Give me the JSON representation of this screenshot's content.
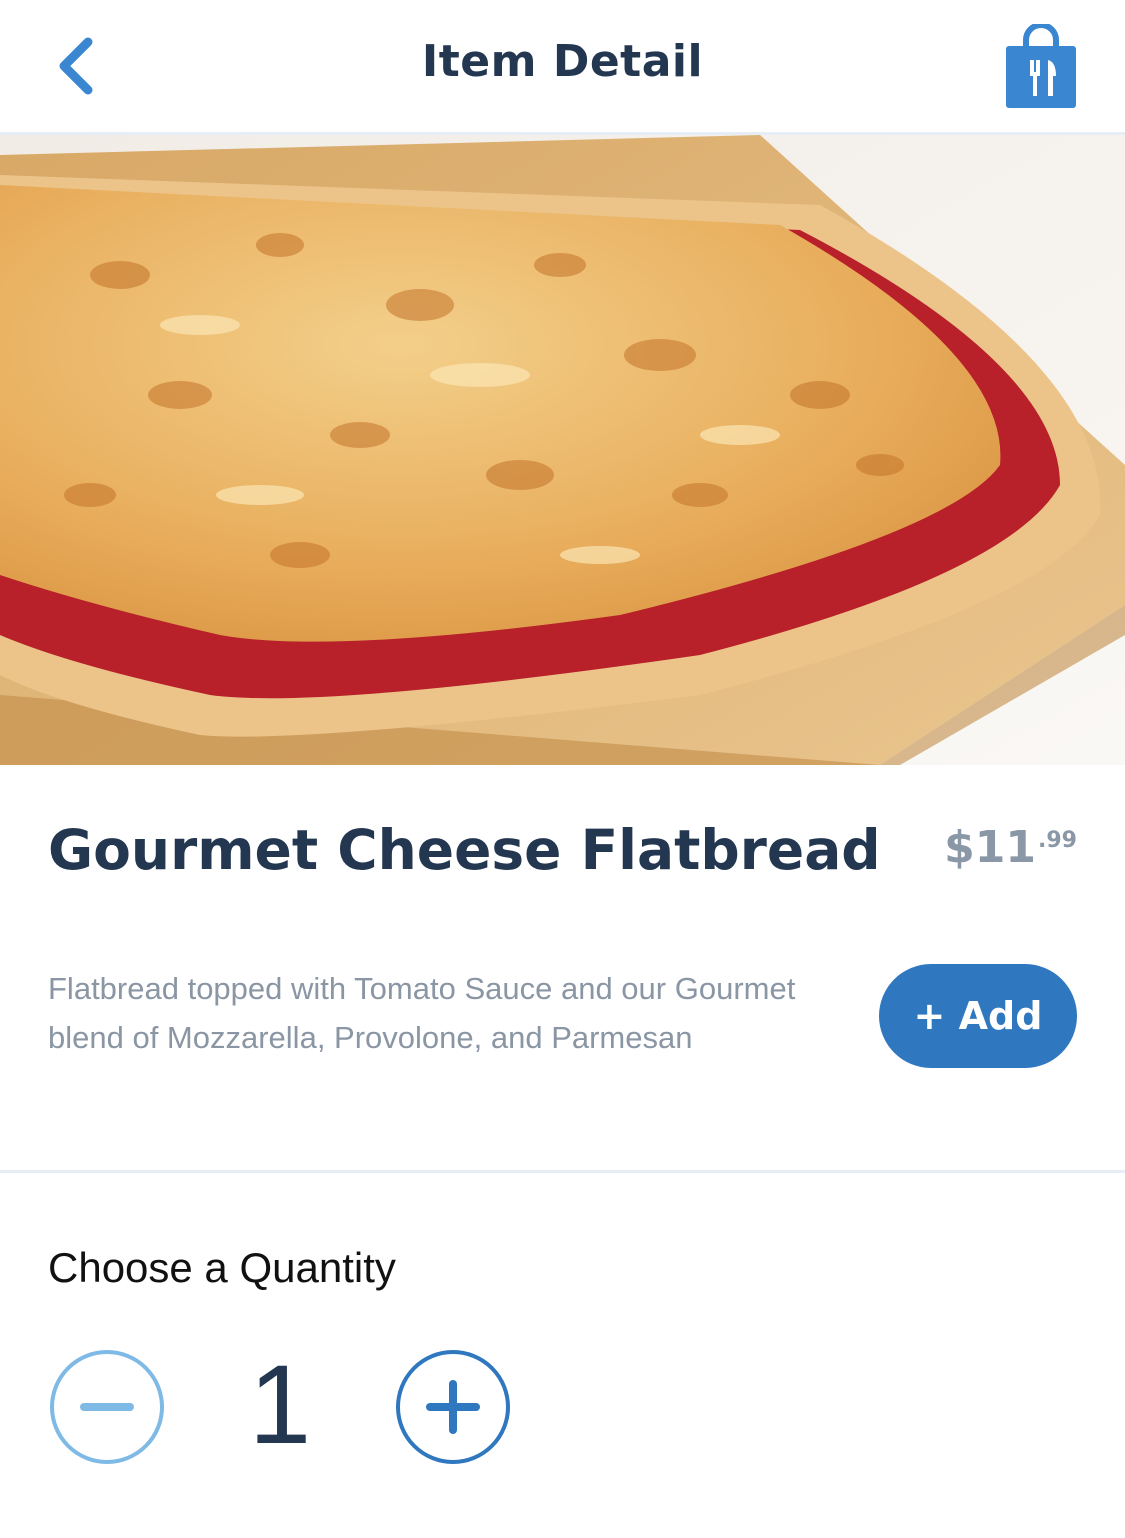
{
  "header": {
    "title": "Item Detail",
    "back_icon": "chevron-left-icon",
    "bag_icon": "mobile-order-bag-icon"
  },
  "hero": {
    "image_icon": "flatbread-photo"
  },
  "item": {
    "name": "Gourmet Cheese Flatbread",
    "price_dollars": "$11",
    "price_cents": ".99",
    "description": "Flatbread topped with Tomato Sauce and our Gourmet blend of Mozzarella, Provolone, and Parmesan",
    "add_label": "+ Add"
  },
  "quantity": {
    "label": "Choose a Quantity",
    "value": "1",
    "minus_icon": "minus-icon",
    "plus_icon": "plus-icon"
  },
  "colors": {
    "accent": "#2f77bf",
    "accent_light": "#7fb9e6",
    "title_text": "#243750",
    "muted_text": "#8a96a4"
  }
}
